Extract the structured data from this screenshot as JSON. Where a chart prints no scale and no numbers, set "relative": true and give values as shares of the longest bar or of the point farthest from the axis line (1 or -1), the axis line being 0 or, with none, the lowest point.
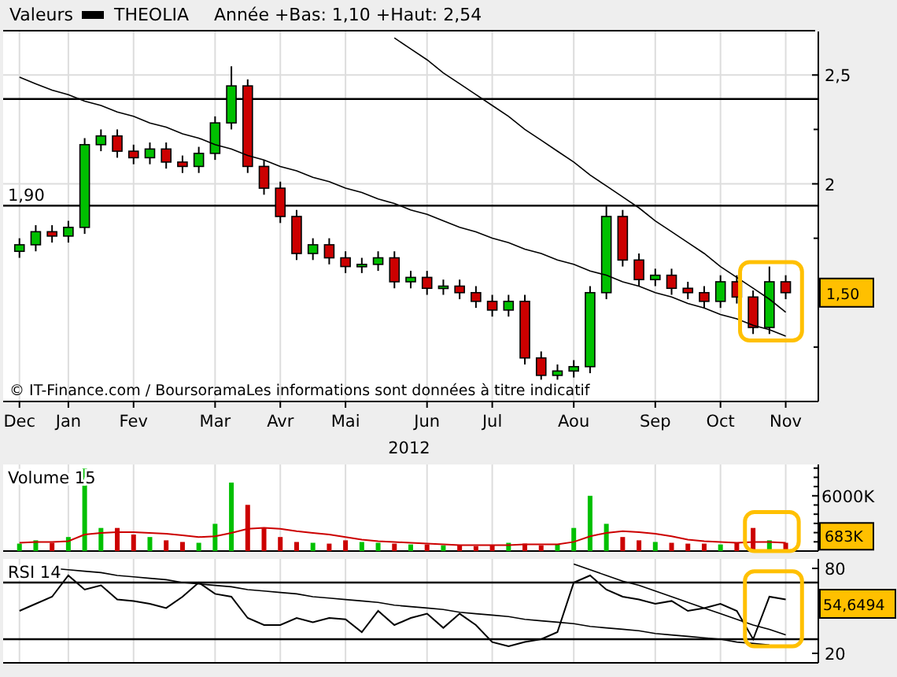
{
  "header": {
    "label": "Valeurs",
    "range": "Année +Bas: 1,10 +Haut: 2,54"
  },
  "price_panel": {
    "last_value": "1,50",
    "credit": "© IT-Finance.com / BoursoramaLes informations sont données à titre indicatif",
    "chart_data": {
      "type": "candlestick",
      "xlabel": "2012",
      "grid": true,
      "categories": [
        "Dec",
        null,
        null,
        "Jan",
        null,
        null,
        null,
        "Fev",
        null,
        null,
        null,
        null,
        "Mar",
        null,
        null,
        null,
        "Avr",
        null,
        null,
        null,
        "Mai",
        null,
        null,
        null,
        null,
        "Jun",
        null,
        null,
        null,
        "Jul",
        null,
        null,
        null,
        null,
        "Aou",
        null,
        null,
        null,
        null,
        "Sep",
        null,
        null,
        null,
        "Oct",
        null,
        null,
        null,
        "Nov"
      ],
      "ylim": [
        1.0,
        2.7
      ],
      "yticks": [
        {
          "value": 2.5,
          "label": "2,5"
        },
        {
          "value": 2,
          "label": "2"
        }
      ],
      "series": [
        {
          "name": "THEOLIA",
          "color": "#000000",
          "ohlc": [
            [
              1.69,
              1.75,
              1.66,
              1.72
            ],
            [
              1.72,
              1.81,
              1.69,
              1.78
            ],
            [
              1.78,
              1.81,
              1.73,
              1.76
            ],
            [
              1.76,
              1.83,
              1.73,
              1.8
            ],
            [
              1.8,
              2.21,
              1.77,
              2.18
            ],
            [
              2.18,
              2.25,
              2.15,
              2.22
            ],
            [
              2.22,
              2.25,
              2.12,
              2.15
            ],
            [
              2.15,
              2.18,
              2.09,
              2.12
            ],
            [
              2.12,
              2.19,
              2.09,
              2.16
            ],
            [
              2.16,
              2.19,
              2.07,
              2.1
            ],
            [
              2.1,
              2.13,
              2.05,
              2.08
            ],
            [
              2.08,
              2.17,
              2.05,
              2.14
            ],
            [
              2.14,
              2.31,
              2.11,
              2.28
            ],
            [
              2.28,
              2.54,
              2.25,
              2.45
            ],
            [
              2.45,
              2.48,
              2.05,
              2.08
            ],
            [
              2.08,
              2.11,
              1.95,
              1.98
            ],
            [
              1.98,
              2.01,
              1.82,
              1.85
            ],
            [
              1.85,
              1.88,
              1.65,
              1.68
            ],
            [
              1.68,
              1.75,
              1.65,
              1.72
            ],
            [
              1.72,
              1.75,
              1.63,
              1.66
            ],
            [
              1.66,
              1.69,
              1.59,
              1.62
            ],
            [
              1.62,
              1.66,
              1.59,
              1.63
            ],
            [
              1.63,
              1.69,
              1.6,
              1.66
            ],
            [
              1.66,
              1.69,
              1.52,
              1.55
            ],
            [
              1.55,
              1.6,
              1.52,
              1.57
            ],
            [
              1.57,
              1.6,
              1.49,
              1.52
            ],
            [
              1.52,
              1.56,
              1.49,
              1.53
            ],
            [
              1.53,
              1.56,
              1.47,
              1.5
            ],
            [
              1.5,
              1.53,
              1.43,
              1.46
            ],
            [
              1.46,
              1.49,
              1.39,
              1.42
            ],
            [
              1.42,
              1.49,
              1.39,
              1.46
            ],
            [
              1.46,
              1.49,
              1.17,
              1.2
            ],
            [
              1.2,
              1.23,
              1.1,
              1.12
            ],
            [
              1.12,
              1.17,
              1.1,
              1.14
            ],
            [
              1.14,
              1.19,
              1.11,
              1.16
            ],
            [
              1.16,
              1.53,
              1.13,
              1.5
            ],
            [
              1.5,
              1.9,
              1.47,
              1.85
            ],
            [
              1.85,
              1.88,
              1.62,
              1.65
            ],
            [
              1.65,
              1.68,
              1.53,
              1.56
            ],
            [
              1.56,
              1.61,
              1.53,
              1.58
            ],
            [
              1.58,
              1.61,
              1.49,
              1.52
            ],
            [
              1.52,
              1.55,
              1.47,
              1.5
            ],
            [
              1.5,
              1.53,
              1.43,
              1.46
            ],
            [
              1.46,
              1.58,
              1.43,
              1.55
            ],
            [
              1.55,
              1.58,
              1.45,
              1.48
            ],
            [
              1.48,
              1.51,
              1.31,
              1.34
            ],
            [
              1.34,
              1.62,
              1.31,
              1.55
            ],
            [
              1.55,
              1.58,
              1.47,
              1.5
            ]
          ]
        },
        {
          "type": "line",
          "color": "#000000",
          "values": [
            2.49,
            2.46,
            2.43,
            2.41,
            2.38,
            2.36,
            2.33,
            2.31,
            2.28,
            2.26,
            2.23,
            2.21,
            2.18,
            2.16,
            2.13,
            2.11,
            2.08,
            2.06,
            2.03,
            2.01,
            1.98,
            1.96,
            1.93,
            1.91,
            1.88,
            1.86,
            1.83,
            1.8,
            1.78,
            1.75,
            1.73,
            1.7,
            1.68,
            1.65,
            1.63,
            1.6,
            1.58,
            1.55,
            1.53,
            1.5,
            1.48,
            1.45,
            1.43,
            1.4,
            1.38,
            1.35,
            1.33,
            1.3
          ]
        },
        {
          "type": "line",
          "color": "#000000",
          "values": [
            null,
            null,
            null,
            null,
            null,
            null,
            null,
            null,
            null,
            null,
            null,
            null,
            null,
            null,
            null,
            null,
            null,
            null,
            null,
            null,
            null,
            null,
            null,
            2.67,
            2.62,
            2.57,
            2.51,
            2.46,
            2.41,
            2.36,
            2.31,
            2.25,
            2.2,
            2.15,
            2.1,
            2.04,
            1.99,
            1.94,
            1.89,
            1.83,
            1.78,
            1.73,
            1.68,
            1.62,
            1.57,
            1.52,
            1.47,
            1.41
          ]
        }
      ],
      "ref_lines": [
        {
          "axis": "y",
          "value": 2.39
        },
        {
          "axis": "y",
          "value": 1.9,
          "label": "1,90"
        }
      ]
    }
  },
  "volume_panel": {
    "title": "Volume 15",
    "last_value": "683K",
    "chart_data": {
      "type": "bar",
      "relative": true,
      "grid": true,
      "categories": [
        null,
        null,
        null,
        null,
        null,
        null,
        null,
        null,
        null,
        null,
        null,
        null,
        null,
        null,
        null,
        null,
        null,
        null,
        null,
        null,
        null,
        null,
        null,
        null,
        null,
        null,
        null,
        null,
        null,
        null,
        null,
        null,
        null,
        null,
        null,
        null,
        null,
        null,
        null,
        null,
        null,
        null,
        null,
        null,
        null,
        null,
        null,
        null
      ],
      "series": [
        {
          "colors": [
            "#00c000",
            "#00c000",
            "#cc0000",
            "#00c000",
            "#00c000",
            "#00c000",
            "#cc0000",
            "#cc0000",
            "#00c000",
            "#cc0000",
            "#cc0000",
            "#00c000",
            "#00c000",
            "#00c000",
            "#cc0000",
            "#cc0000",
            "#cc0000",
            "#cc0000",
            "#00c000",
            "#cc0000",
            "#cc0000",
            "#00c000",
            "#00c000",
            "#cc0000",
            "#00c000",
            "#cc0000",
            "#00c000",
            "#cc0000",
            "#cc0000",
            "#cc0000",
            "#00c000",
            "#cc0000",
            "#cc0000",
            "#00c000",
            "#00c000",
            "#00c000",
            "#00c000",
            "#cc0000",
            "#cc0000",
            "#00c000",
            "#cc0000",
            "#cc0000",
            "#cc0000",
            "#00c000",
            "#cc0000",
            "#cc0000",
            "#00c000",
            "#cc0000"
          ],
          "values": [
            0.09,
            0.13,
            0.1,
            0.17,
            1,
            0.28,
            0.28,
            0.2,
            0.17,
            0.13,
            0.11,
            0.1,
            0.33,
            0.83,
            0.56,
            0.28,
            0.17,
            0.11,
            0.1,
            0.09,
            0.13,
            0.11,
            0.1,
            0.09,
            0.08,
            0.08,
            0.07,
            0.07,
            0.06,
            0.07,
            0.1,
            0.09,
            0.07,
            0.08,
            0.28,
            0.67,
            0.33,
            0.17,
            0.13,
            0.11,
            0.1,
            0.09,
            0.09,
            0.08,
            0.1,
            0.28,
            0.13,
            0.1
          ]
        },
        {
          "type": "line",
          "color": "#cc0000",
          "values": [
            0.1,
            0.11,
            0.11,
            0.12,
            0.2,
            0.22,
            0.23,
            0.23,
            0.22,
            0.21,
            0.19,
            0.17,
            0.18,
            0.22,
            0.27,
            0.28,
            0.27,
            0.24,
            0.22,
            0.2,
            0.17,
            0.14,
            0.12,
            0.11,
            0.1,
            0.09,
            0.08,
            0.07,
            0.07,
            0.07,
            0.07,
            0.08,
            0.08,
            0.08,
            0.11,
            0.18,
            0.22,
            0.24,
            0.23,
            0.21,
            0.18,
            0.14,
            0.12,
            0.11,
            0.1,
            0.11,
            0.11,
            0.1
          ]
        }
      ],
      "annotations": [
        {
          "text": "6000K"
        }
      ]
    }
  },
  "rsi_panel": {
    "last_value": "54,6494",
    "chart_data": {
      "type": "line",
      "grid": true,
      "categories": [
        null,
        null,
        null,
        null,
        null,
        null,
        null,
        null,
        null,
        null,
        null,
        null,
        null,
        null,
        null,
        null,
        null,
        null,
        null,
        null,
        null,
        null,
        null,
        null,
        null,
        null,
        null,
        null,
        null,
        null,
        null,
        null,
        null,
        null,
        null,
        null,
        null,
        null,
        null,
        null,
        null,
        null,
        null,
        null,
        null,
        null,
        null,
        null
      ],
      "ylim": [
        13.3,
        86.7
      ],
      "yticks": [
        {
          "value": 80,
          "label": "80"
        },
        {
          "value": 20,
          "label": "20"
        }
      ],
      "series": [
        {
          "name": "RSI 14",
          "color": "#000000",
          "values": [
            50,
            55,
            60,
            75,
            65,
            68,
            58,
            57,
            55,
            52,
            60,
            70,
            62,
            60,
            45,
            40,
            40,
            45,
            42,
            45,
            44,
            35,
            50,
            40,
            45,
            48,
            38,
            48,
            40,
            28,
            25,
            28,
            30,
            35,
            70,
            75,
            65,
            60,
            58,
            55,
            57,
            50,
            52,
            55,
            50,
            30,
            60,
            58
          ]
        },
        {
          "type": "line",
          "color": "#000000",
          "values": [
            null,
            null,
            80,
            79,
            78,
            77,
            75,
            74,
            73,
            72,
            70,
            69,
            68,
            67,
            65,
            64,
            63,
            62,
            60,
            59,
            58,
            57,
            56,
            54,
            53,
            52,
            51,
            49,
            48,
            47,
            46,
            44,
            43,
            42,
            41,
            39,
            38,
            37,
            36,
            34,
            33,
            32,
            31,
            30,
            28,
            27,
            26,
            null
          ]
        },
        {
          "type": "line",
          "color": "#000000",
          "values": [
            null,
            null,
            null,
            null,
            null,
            null,
            null,
            null,
            null,
            null,
            null,
            null,
            null,
            null,
            null,
            null,
            null,
            null,
            null,
            null,
            null,
            null,
            null,
            null,
            null,
            null,
            null,
            null,
            null,
            null,
            null,
            null,
            null,
            null,
            83,
            79,
            75,
            71,
            68,
            64,
            60,
            56,
            52,
            48,
            44,
            40,
            37,
            33
          ]
        }
      ],
      "ref_lines": [
        {
          "axis": "y",
          "value": 70
        },
        {
          "axis": "y",
          "value": 30
        }
      ]
    }
  }
}
